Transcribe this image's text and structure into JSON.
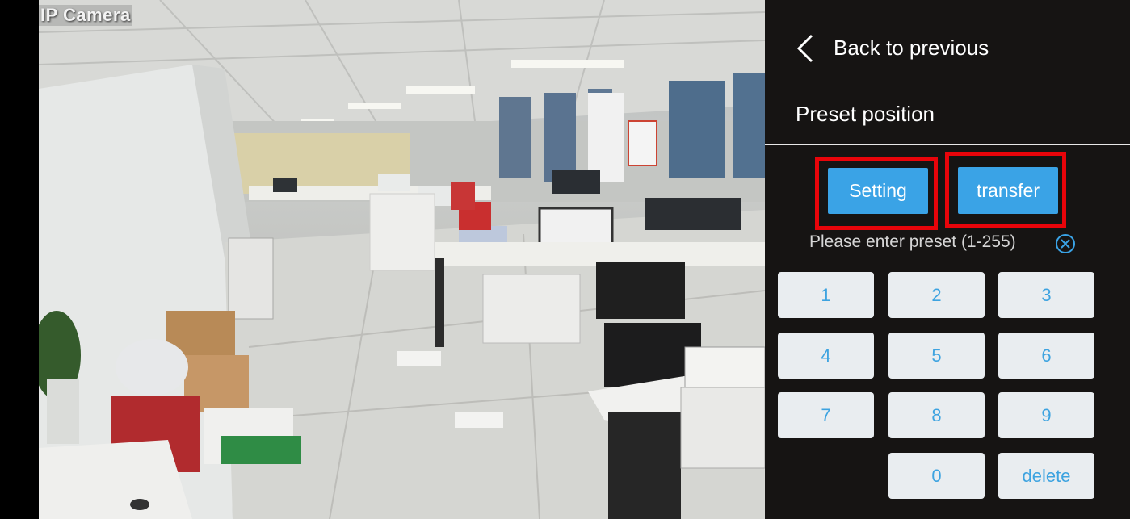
{
  "camera": {
    "label": "IP Camera"
  },
  "panel": {
    "back_label": "Back to previous",
    "section_title": "Preset position",
    "setting_label": "Setting",
    "transfer_label": "transfer",
    "prompt": "Please enter preset (1-255)",
    "accent_color": "#3aa3e6",
    "highlight_color": "#e8040a",
    "keys": [
      "1",
      "2",
      "3",
      "4",
      "5",
      "6",
      "7",
      "8",
      "9",
      "0",
      "delete"
    ]
  }
}
